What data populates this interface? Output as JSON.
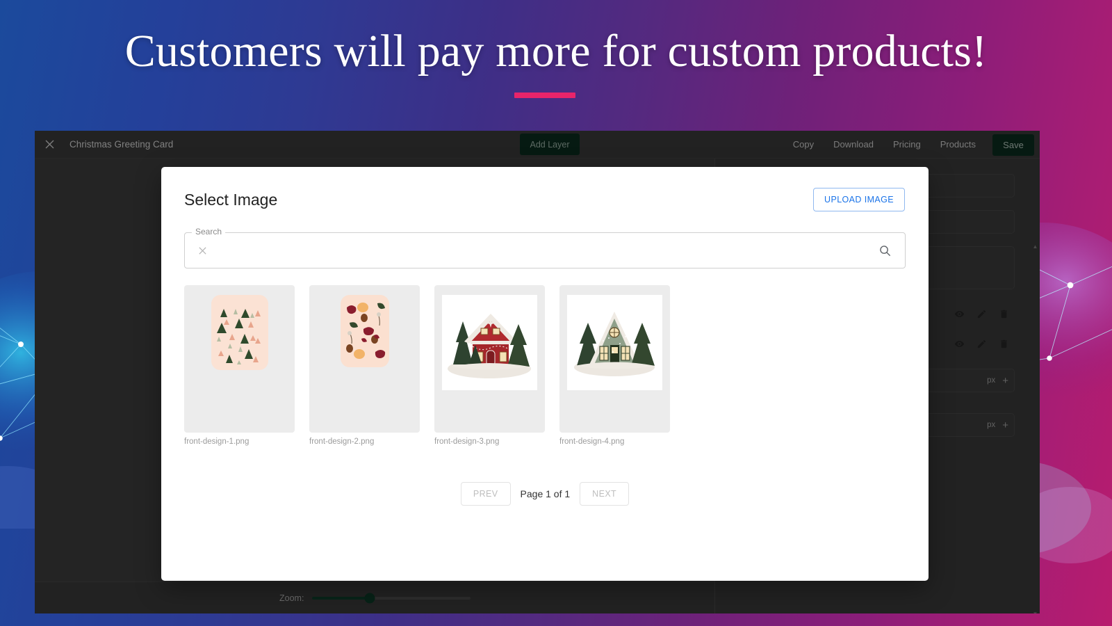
{
  "promo": {
    "headline": "Customers will pay more for custom products!",
    "accent_color": "#e8246a"
  },
  "editor": {
    "close_icon": "close-icon",
    "document_title": "Christmas Greeting Card",
    "add_layer_label": "Add Layer",
    "nav": [
      {
        "label": "Copy"
      },
      {
        "label": "Download"
      },
      {
        "label": "Pricing"
      },
      {
        "label": "Products"
      }
    ],
    "save_label": "Save",
    "zoom": {
      "label": "Zoom:",
      "value_percent": 36
    },
    "properties": {
      "row_icons": [
        "eye-icon",
        "pencil-icon",
        "trash-icon"
      ],
      "unit": "px",
      "stepper_plus": "+"
    },
    "button_color": "#0b2e20"
  },
  "dialog": {
    "title": "Select Image",
    "upload_label": "UPLOAD IMAGE",
    "upload_color": "#1a73e8",
    "search": {
      "legend": "Search",
      "value": "",
      "placeholder": "",
      "clear_icon": "close-icon",
      "search_icon": "search-icon"
    },
    "images": [
      {
        "name": "front-design-1.png",
        "art": "trees-pattern"
      },
      {
        "name": "front-design-2.png",
        "art": "birds-pattern"
      },
      {
        "name": "front-design-3.png",
        "art": "red-cabin"
      },
      {
        "name": "front-design-4.png",
        "art": "green-house"
      }
    ],
    "pagination": {
      "prev_label": "PREV",
      "next_label": "NEXT",
      "status": "Page 1 of 1"
    }
  }
}
